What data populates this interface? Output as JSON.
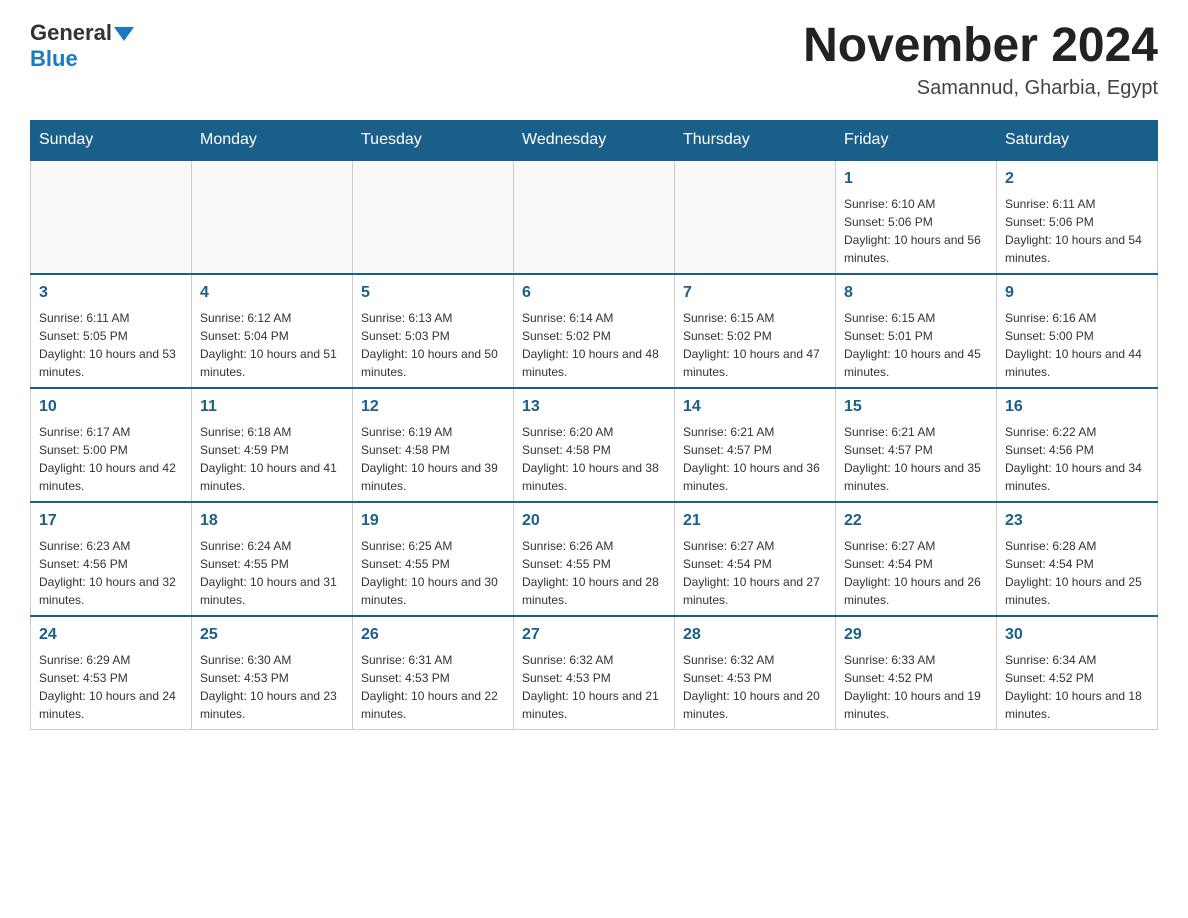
{
  "header": {
    "logo_general": "General",
    "logo_blue": "Blue",
    "month_title": "November 2024",
    "location": "Samannud, Gharbia, Egypt"
  },
  "weekdays": [
    "Sunday",
    "Monday",
    "Tuesday",
    "Wednesday",
    "Thursday",
    "Friday",
    "Saturday"
  ],
  "weeks": [
    {
      "days": [
        {
          "num": "",
          "info": ""
        },
        {
          "num": "",
          "info": ""
        },
        {
          "num": "",
          "info": ""
        },
        {
          "num": "",
          "info": ""
        },
        {
          "num": "",
          "info": ""
        },
        {
          "num": "1",
          "info": "Sunrise: 6:10 AM\nSunset: 5:06 PM\nDaylight: 10 hours and 56 minutes."
        },
        {
          "num": "2",
          "info": "Sunrise: 6:11 AM\nSunset: 5:06 PM\nDaylight: 10 hours and 54 minutes."
        }
      ]
    },
    {
      "days": [
        {
          "num": "3",
          "info": "Sunrise: 6:11 AM\nSunset: 5:05 PM\nDaylight: 10 hours and 53 minutes."
        },
        {
          "num": "4",
          "info": "Sunrise: 6:12 AM\nSunset: 5:04 PM\nDaylight: 10 hours and 51 minutes."
        },
        {
          "num": "5",
          "info": "Sunrise: 6:13 AM\nSunset: 5:03 PM\nDaylight: 10 hours and 50 minutes."
        },
        {
          "num": "6",
          "info": "Sunrise: 6:14 AM\nSunset: 5:02 PM\nDaylight: 10 hours and 48 minutes."
        },
        {
          "num": "7",
          "info": "Sunrise: 6:15 AM\nSunset: 5:02 PM\nDaylight: 10 hours and 47 minutes."
        },
        {
          "num": "8",
          "info": "Sunrise: 6:15 AM\nSunset: 5:01 PM\nDaylight: 10 hours and 45 minutes."
        },
        {
          "num": "9",
          "info": "Sunrise: 6:16 AM\nSunset: 5:00 PM\nDaylight: 10 hours and 44 minutes."
        }
      ]
    },
    {
      "days": [
        {
          "num": "10",
          "info": "Sunrise: 6:17 AM\nSunset: 5:00 PM\nDaylight: 10 hours and 42 minutes."
        },
        {
          "num": "11",
          "info": "Sunrise: 6:18 AM\nSunset: 4:59 PM\nDaylight: 10 hours and 41 minutes."
        },
        {
          "num": "12",
          "info": "Sunrise: 6:19 AM\nSunset: 4:58 PM\nDaylight: 10 hours and 39 minutes."
        },
        {
          "num": "13",
          "info": "Sunrise: 6:20 AM\nSunset: 4:58 PM\nDaylight: 10 hours and 38 minutes."
        },
        {
          "num": "14",
          "info": "Sunrise: 6:21 AM\nSunset: 4:57 PM\nDaylight: 10 hours and 36 minutes."
        },
        {
          "num": "15",
          "info": "Sunrise: 6:21 AM\nSunset: 4:57 PM\nDaylight: 10 hours and 35 minutes."
        },
        {
          "num": "16",
          "info": "Sunrise: 6:22 AM\nSunset: 4:56 PM\nDaylight: 10 hours and 34 minutes."
        }
      ]
    },
    {
      "days": [
        {
          "num": "17",
          "info": "Sunrise: 6:23 AM\nSunset: 4:56 PM\nDaylight: 10 hours and 32 minutes."
        },
        {
          "num": "18",
          "info": "Sunrise: 6:24 AM\nSunset: 4:55 PM\nDaylight: 10 hours and 31 minutes."
        },
        {
          "num": "19",
          "info": "Sunrise: 6:25 AM\nSunset: 4:55 PM\nDaylight: 10 hours and 30 minutes."
        },
        {
          "num": "20",
          "info": "Sunrise: 6:26 AM\nSunset: 4:55 PM\nDaylight: 10 hours and 28 minutes."
        },
        {
          "num": "21",
          "info": "Sunrise: 6:27 AM\nSunset: 4:54 PM\nDaylight: 10 hours and 27 minutes."
        },
        {
          "num": "22",
          "info": "Sunrise: 6:27 AM\nSunset: 4:54 PM\nDaylight: 10 hours and 26 minutes."
        },
        {
          "num": "23",
          "info": "Sunrise: 6:28 AM\nSunset: 4:54 PM\nDaylight: 10 hours and 25 minutes."
        }
      ]
    },
    {
      "days": [
        {
          "num": "24",
          "info": "Sunrise: 6:29 AM\nSunset: 4:53 PM\nDaylight: 10 hours and 24 minutes."
        },
        {
          "num": "25",
          "info": "Sunrise: 6:30 AM\nSunset: 4:53 PM\nDaylight: 10 hours and 23 minutes."
        },
        {
          "num": "26",
          "info": "Sunrise: 6:31 AM\nSunset: 4:53 PM\nDaylight: 10 hours and 22 minutes."
        },
        {
          "num": "27",
          "info": "Sunrise: 6:32 AM\nSunset: 4:53 PM\nDaylight: 10 hours and 21 minutes."
        },
        {
          "num": "28",
          "info": "Sunrise: 6:32 AM\nSunset: 4:53 PM\nDaylight: 10 hours and 20 minutes."
        },
        {
          "num": "29",
          "info": "Sunrise: 6:33 AM\nSunset: 4:52 PM\nDaylight: 10 hours and 19 minutes."
        },
        {
          "num": "30",
          "info": "Sunrise: 6:34 AM\nSunset: 4:52 PM\nDaylight: 10 hours and 18 minutes."
        }
      ]
    }
  ]
}
